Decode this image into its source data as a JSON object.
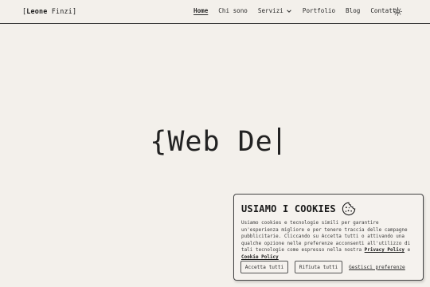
{
  "header": {
    "logo": {
      "bracket_open": "[",
      "first": "Leone",
      "last": "Finzi",
      "bracket_close": "]"
    },
    "nav": [
      {
        "label": "Home",
        "active": true
      },
      {
        "label": "Chi sono"
      },
      {
        "label": "Servizi",
        "has_dropdown": true
      },
      {
        "label": "Portfolio"
      },
      {
        "label": "Blog"
      },
      {
        "label": "Contatti"
      }
    ],
    "theme_icon": "sun-icon"
  },
  "hero": {
    "brace": "{",
    "text": "Web De"
  },
  "cookie_banner": {
    "title": "USIAMO I COOKIES",
    "icon": "cookie-icon",
    "text_part1": "Usiamo cookies e tecnologie simili per garantire un'esperienza migliore e per tenere traccia delle campagne pubblicitarie. Cliccando su Accetta tutti o attivando una qualche opzione nelle preferenze acconsenti all'utilizzo di tali tecnologie come espresso nella nostra ",
    "privacy_link": "Privacy Policy",
    "text_and": " e ",
    "cookie_link": "Cookie Policy",
    "accept_label": "Accetta tutti",
    "reject_label": "Rifiuta tutti",
    "prefs_label": "Gestisci preferenze"
  }
}
